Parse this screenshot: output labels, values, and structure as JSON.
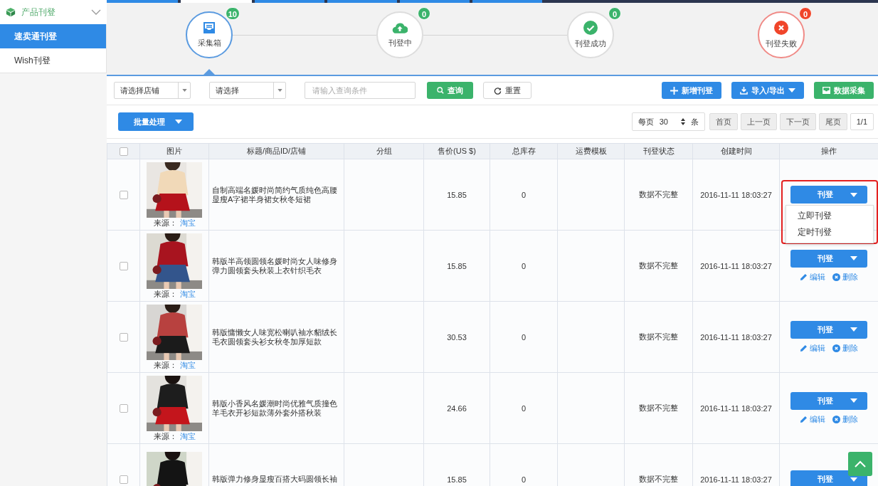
{
  "sidebar": {
    "header": "产品刊登",
    "expanded": true,
    "items": [
      {
        "label": "速卖通刊登",
        "selected": true
      },
      {
        "label": "Wish刊登",
        "selected": false
      }
    ]
  },
  "steps": [
    {
      "label": "采集箱",
      "count": "10",
      "kind": "inbox",
      "selected": true
    },
    {
      "label": "刊登中",
      "count": "0",
      "kind": "upload",
      "selected": false
    },
    {
      "label": "刊登成功",
      "count": "0",
      "kind": "success",
      "selected": false
    },
    {
      "label": "刊登失败",
      "count": "0",
      "kind": "fail",
      "selected": false
    }
  ],
  "toolbar": {
    "shop_select": "请选择店铺",
    "select": "请选择",
    "search": {
      "placeholder": "请输入查询条件"
    },
    "query_button": "查询",
    "reset_button": "重置",
    "add_button": "新增刊登",
    "import_export_button": "导入/导出",
    "collect_button": "数据采集"
  },
  "batch_button": "批量处理",
  "pagination": {
    "per_page_label": "每页",
    "per_page": "30",
    "unit": "条",
    "buttons": [
      "首页",
      "上一页",
      "下一页",
      "尾页"
    ],
    "page": "1/1"
  },
  "table": {
    "header_checked": false,
    "columns": [
      "图片",
      "标题/商品ID/店铺",
      "分组",
      "售价(US $)",
      "总库存",
      "运费模板",
      "刊登状态",
      "创建时间",
      "操作"
    ],
    "rows": [
      {
        "checked": false,
        "source_label": "来源：",
        "source": "淘宝",
        "title": "自制高端名媛时尚简约气质纯色高腰显瘦A字裙半身裙女秋冬短裙",
        "price": "15.85",
        "stock": "0",
        "status": "数据不完整",
        "created": "2016-11-11 18:03:27",
        "publish": "刊登",
        "menu": [
          "立即刊登",
          "定时刊登"
        ],
        "highlighted": true
      },
      {
        "checked": false,
        "source_label": "来源：",
        "source": "淘宝",
        "title": "韩版半高领圆领名媛时尚女人味修身弹力圆领套头秋装上衣针织毛衣",
        "price": "15.85",
        "stock": "0",
        "status": "数据不完整",
        "created": "2016-11-11 18:03:27",
        "publish": "刊登",
        "edit": "编辑",
        "delete": "删除"
      },
      {
        "checked": false,
        "source_label": "来源：",
        "source": "淘宝",
        "title": "韩版慵懒女人味宽松喇叭袖水貂绒长毛衣圆领套头衫女秋冬加厚短款",
        "price": "30.53",
        "stock": "0",
        "status": "数据不完整",
        "created": "2016-11-11 18:03:27",
        "publish": "刊登",
        "edit": "编辑",
        "delete": "删除"
      },
      {
        "checked": false,
        "source_label": "来源：",
        "source": "淘宝",
        "title": "韩版小香风名媛潮时尚优雅气质撞色羊毛衣开衫短款薄外套外搭秋装",
        "price": "24.66",
        "stock": "0",
        "status": "数据不完整",
        "created": "2016-11-11 18:03:27",
        "publish": "刊登",
        "edit": "编辑",
        "delete": "删除"
      },
      {
        "checked": false,
        "title": "韩版弹力修身显瘦百搭大码圆领长袖",
        "price": "15.85",
        "stock": "0",
        "status": "数据不完整",
        "created": "2016-11-11 18:03:27",
        "publish": "刊登"
      }
    ]
  }
}
